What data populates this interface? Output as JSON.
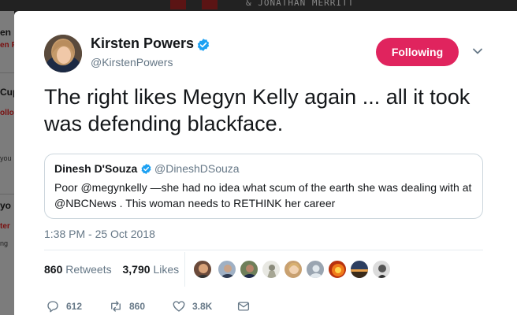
{
  "background": {
    "book_title": "& JONATHAN MERRITT",
    "side_fragments": [
      "en",
      "en P",
      "Cup",
      "ollo",
      "you",
      "yo",
      "ter",
      "ng"
    ]
  },
  "tweet": {
    "author": {
      "name": "Kirsten Powers",
      "handle": "@KirstenPowers",
      "avatar_icon": "profile-photo",
      "verified": true
    },
    "follow_label": "Following",
    "text": "The right likes Megyn Kelly again ... all it took was defending blackface.",
    "quote": {
      "name": "Dinesh D'Souza",
      "handle": "@DineshDSouza",
      "verified": true,
      "text": "Poor @megynkelly —she had no idea what scum of the earth she was dealing with at @NBCNews . This woman needs to RETHINK her career"
    },
    "timestamp": "1:38 PM - 25 Oct 2018",
    "stats": {
      "retweets_count": "860",
      "retweets_label": "Retweets",
      "likes_count": "3,790",
      "likes_label": "Likes"
    },
    "likers": [
      "liker-1",
      "liker-2",
      "liker-3",
      "liker-4",
      "liker-5",
      "liker-6",
      "liker-7",
      "liker-8",
      "liker-9"
    ],
    "actions": {
      "reply_count": "612",
      "retweet_count": "860",
      "like_count": "3.8K"
    }
  },
  "colors": {
    "accent": "#1da1f2",
    "following_button": "#e0245e",
    "retweet_icon": "#657786",
    "secondary_text": "#657786"
  }
}
